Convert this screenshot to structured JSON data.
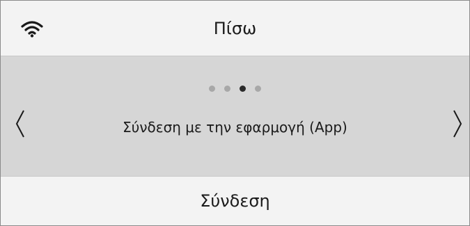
{
  "header": {
    "back_label": "Πίσω",
    "wifi_icon": "wifi-icon"
  },
  "carousel": {
    "page_count": 4,
    "active_index": 2,
    "slide_text": "Σύνδεση με την εφαρμογή (App)",
    "prev_icon": "chevron-left-icon",
    "next_icon": "chevron-right-icon"
  },
  "footer": {
    "action_label": "Σύνδεση"
  },
  "colors": {
    "panel_bg": "#f3f3f3",
    "carousel_bg": "#d6d6d6",
    "dot_inactive": "#a8a8a8",
    "dot_active": "#2a2a2a"
  }
}
